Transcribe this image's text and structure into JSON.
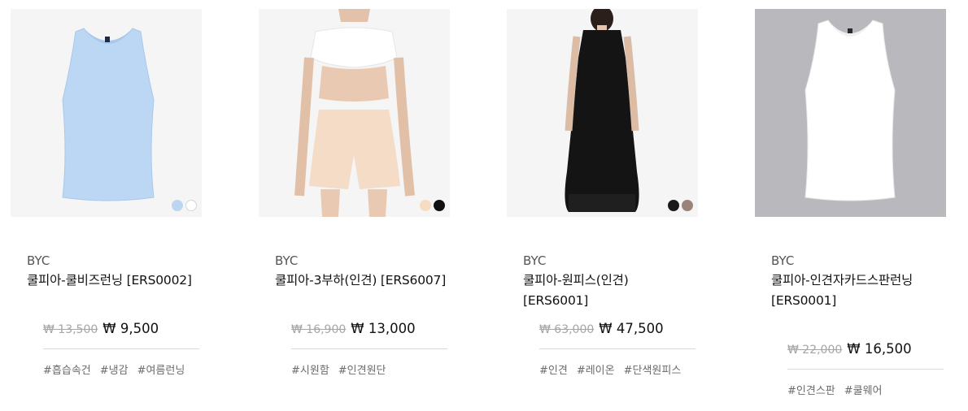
{
  "currency_symbol": "₩",
  "products": [
    {
      "brand": "BYC",
      "name": "쿨피아-쿨비즈런닝 [ERS0002]",
      "original_price": "₩ 13,500",
      "sale_price": "₩ 9,500",
      "tags": [
        "#흡습속건",
        "#냉감",
        "#여름런닝"
      ],
      "swatches": [
        "#bcd6f2",
        "#ffffff"
      ],
      "image": "light-blue-sleeveless-tank-top",
      "background": "#f5f5f5"
    },
    {
      "brand": "BYC",
      "name": "쿨피아-3부하(인견) [ERS6007]",
      "original_price": "₩ 16,900",
      "sale_price": "₩ 13,000",
      "tags": [
        "#시원함",
        "#인견원단"
      ],
      "swatches": [
        "#f6dcc2",
        "#111111"
      ],
      "image": "beige-3-part-shorts-model",
      "background": "#f5f5f5"
    },
    {
      "brand": "BYC",
      "name": "쿨피아-원피스(인견) [ERS6001]",
      "original_price": "₩ 63,000",
      "sale_price": "₩ 47,500",
      "tags": [
        "#인견",
        "#레이온",
        "#단색원피스"
      ],
      "swatches": [
        "#1a1a1a",
        "#9a8478"
      ],
      "image": "black-sleeveless-dress-model",
      "background": "#f5f5f5"
    },
    {
      "brand": "BYC",
      "name": "쿨피아-인견자카드스판런닝 [ERS0001]",
      "original_price": "₩ 22,000",
      "sale_price": "₩ 16,500",
      "tags": [
        "#인견스판",
        "#쿨웨어"
      ],
      "swatches": [],
      "image": "white-sleeveless-tank-top",
      "background": "#b9b9bd"
    }
  ]
}
